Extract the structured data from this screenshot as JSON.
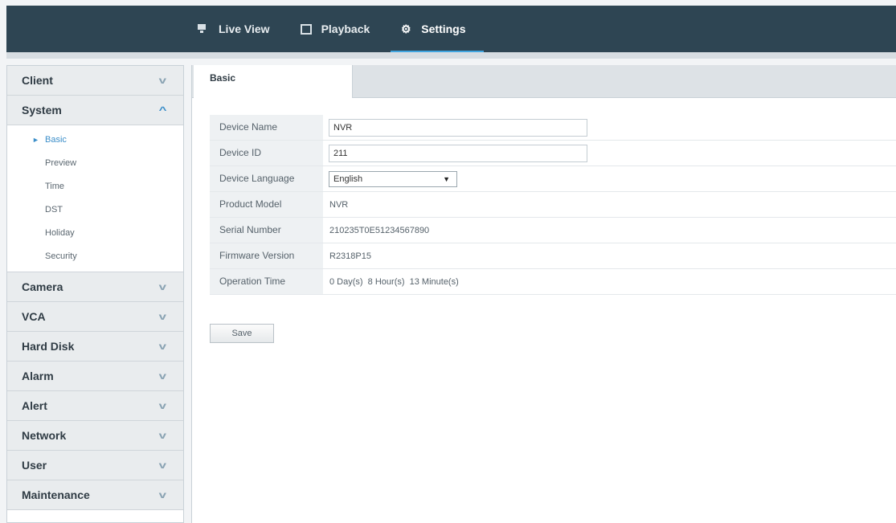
{
  "nav": {
    "items": [
      {
        "label": "Live View",
        "icon": "monitor-icon"
      },
      {
        "label": "Playback",
        "icon": "film-icon"
      },
      {
        "label": "Settings",
        "icon": "gear-icon",
        "active": true
      }
    ]
  },
  "sidebar": {
    "sections": [
      {
        "label": "Client"
      },
      {
        "label": "System",
        "open": true,
        "items": [
          "Basic",
          "Preview",
          "Time",
          "DST",
          "Holiday",
          "Security"
        ],
        "active_item": "Basic"
      },
      {
        "label": "Camera"
      },
      {
        "label": "VCA"
      },
      {
        "label": "Hard Disk"
      },
      {
        "label": "Alarm"
      },
      {
        "label": "Alert"
      },
      {
        "label": "Network"
      },
      {
        "label": "User"
      },
      {
        "label": "Maintenance"
      }
    ]
  },
  "tab": {
    "label": "Basic"
  },
  "form": {
    "device_name": {
      "label": "Device Name",
      "value": "NVR"
    },
    "device_id": {
      "label": "Device ID",
      "value": "211"
    },
    "device_language": {
      "label": "Device Language",
      "value": "English"
    },
    "product_model": {
      "label": "Product Model",
      "value": "NVR"
    },
    "serial_number": {
      "label": "Serial Number",
      "value": "210235T0E51234567890"
    },
    "firmware_version": {
      "label": "Firmware Version",
      "value": "R2318P15"
    },
    "operation_time": {
      "label": "Operation Time",
      "value": "0 Day(s)  8 Hour(s)  13 Minute(s)"
    }
  },
  "save_label": "Save",
  "colors": {
    "topbar": "#2e4553",
    "accent": "#3b8ec9"
  }
}
